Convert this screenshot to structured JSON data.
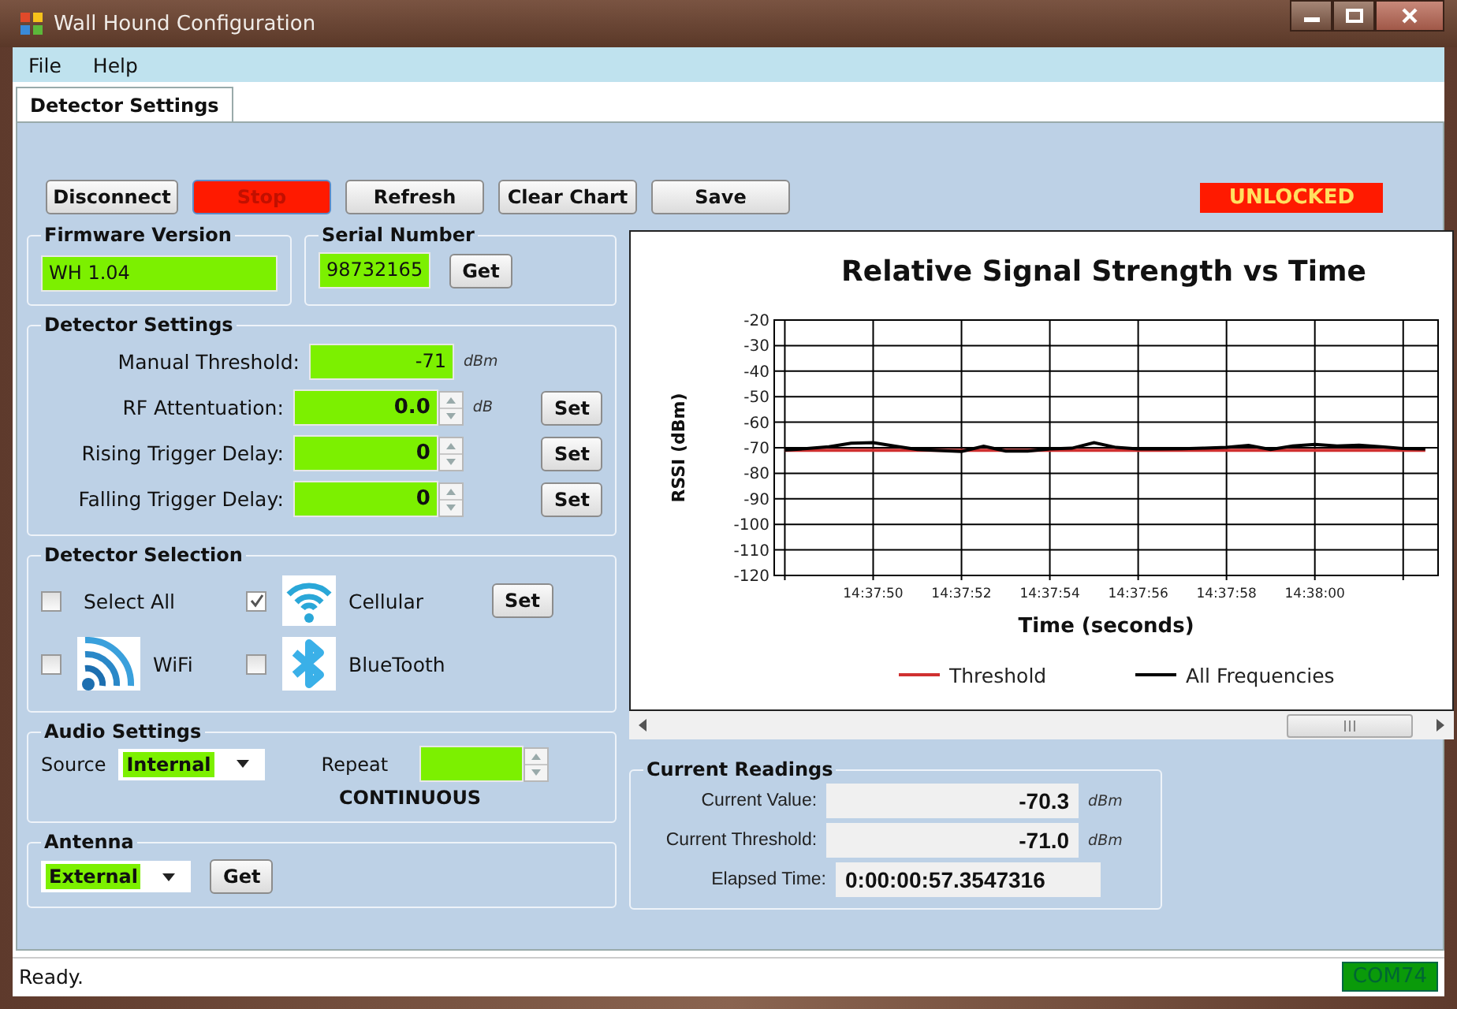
{
  "window": {
    "title": "Wall Hound Configuration"
  },
  "menu": [
    {
      "label": "File"
    },
    {
      "label": "Help"
    }
  ],
  "tabs": [
    {
      "label": "Detector Settings",
      "selected": true
    }
  ],
  "toolbar": {
    "buttons": [
      {
        "label": "Disconnect",
        "kind": "normal"
      },
      {
        "label": "Stop",
        "kind": "alert"
      },
      {
        "label": "Refresh",
        "kind": "normal"
      },
      {
        "label": "Clear Chart",
        "kind": "normal"
      },
      {
        "label": "Save",
        "kind": "normal"
      }
    ],
    "lock_status": "UNLOCKED"
  },
  "firmware": {
    "title": "Firmware Version",
    "value": "WH 1.04"
  },
  "serial": {
    "title": "Serial Number",
    "value": "98732165",
    "button": "Get"
  },
  "detector_settings": {
    "title": "Detector Settings",
    "rows": [
      {
        "label": "Manual Threshold:",
        "value": "-71",
        "unit": "dBm",
        "kind": "text"
      },
      {
        "label": "RF Attentuation:",
        "value": "0.0",
        "unit": "dB",
        "kind": "spin",
        "button": "Set"
      },
      {
        "label": "Rising Trigger Delay:",
        "value": "0",
        "kind": "spin",
        "button": "Set"
      },
      {
        "label": "Falling Trigger Delay:",
        "value": "0",
        "kind": "spin",
        "button": "Set"
      }
    ]
  },
  "detector_selection": {
    "title": "Detector Selection",
    "button": "Set",
    "items": [
      {
        "label": "Select All",
        "checked": false,
        "kind": "plain"
      },
      {
        "label": "Cellular",
        "checked": true,
        "kind": "cellular"
      },
      {
        "label": "WiFi",
        "checked": false,
        "kind": "wifi"
      },
      {
        "label": "BlueTooth",
        "checked": false,
        "kind": "bluetooth"
      }
    ]
  },
  "audio": {
    "title": "Audio Settings",
    "source_label": "Source",
    "source": "Internal",
    "repeat_label": "Repeat",
    "repeat_mode": "CONTINUOUS"
  },
  "antenna": {
    "title": "Antenna",
    "value": "External",
    "button": "Get"
  },
  "chart": {
    "chart_data": {
      "type": "line",
      "title": "Relative Signal Strength vs Time",
      "xlabel": "Time (seconds)",
      "ylabel": "RSSI (dBm)",
      "categories": [
        null,
        null,
        null,
        null,
        "14:37:50",
        null,
        null,
        null,
        "14:37:52",
        null,
        null,
        null,
        "14:37:54",
        null,
        null,
        null,
        "14:37:56",
        null,
        null,
        null,
        "14:37:58",
        null,
        null,
        null,
        "14:38:00",
        null,
        null,
        null,
        null,
        null
      ],
      "series": [
        {
          "name": "Threshold",
          "color": "#d03030",
          "values": [
            -71,
            -71,
            -71,
            -71,
            -71,
            -71,
            -71,
            -71,
            -71,
            -71,
            -71,
            -71,
            -71,
            -71,
            -71,
            -71,
            -71,
            -71,
            -71,
            -71,
            -71,
            -71,
            -71,
            -71,
            -71,
            -71,
            -71,
            -71,
            -71,
            -71
          ]
        },
        {
          "name": "All Frequencies",
          "color": "#000000",
          "values": [
            -70.9,
            -70.3,
            -69.6,
            -68.2,
            -68,
            -69.4,
            -70.7,
            -71.1,
            -71.5,
            -69.4,
            -71.3,
            -71.3,
            -70.5,
            -70.2,
            -68,
            -69.9,
            -70.5,
            -70.5,
            -70.4,
            -70.1,
            -69.8,
            -69.1,
            -70.7,
            -69.3,
            -68.7,
            -69.3,
            -69,
            -69.6,
            -70.3,
            -70.5
          ]
        }
      ],
      "legend": "bottom",
      "ylim": [
        -120,
        -20
      ],
      "yticks": [
        -20,
        -30,
        -40,
        -50,
        -60,
        -70,
        -80,
        -90,
        -100,
        -110,
        -120
      ]
    }
  },
  "readings": {
    "title": "Current Readings",
    "rows": [
      {
        "label": "Current Value:",
        "value": "-70.3",
        "unit": "dBm"
      },
      {
        "label": "Current Threshold:",
        "value": "-71.0",
        "unit": "dBm"
      },
      {
        "label": "Elapsed Time:",
        "value": "0:00:00:57.3547316"
      }
    ]
  },
  "status_bar": {
    "text": "Ready.",
    "port": "COM74"
  }
}
